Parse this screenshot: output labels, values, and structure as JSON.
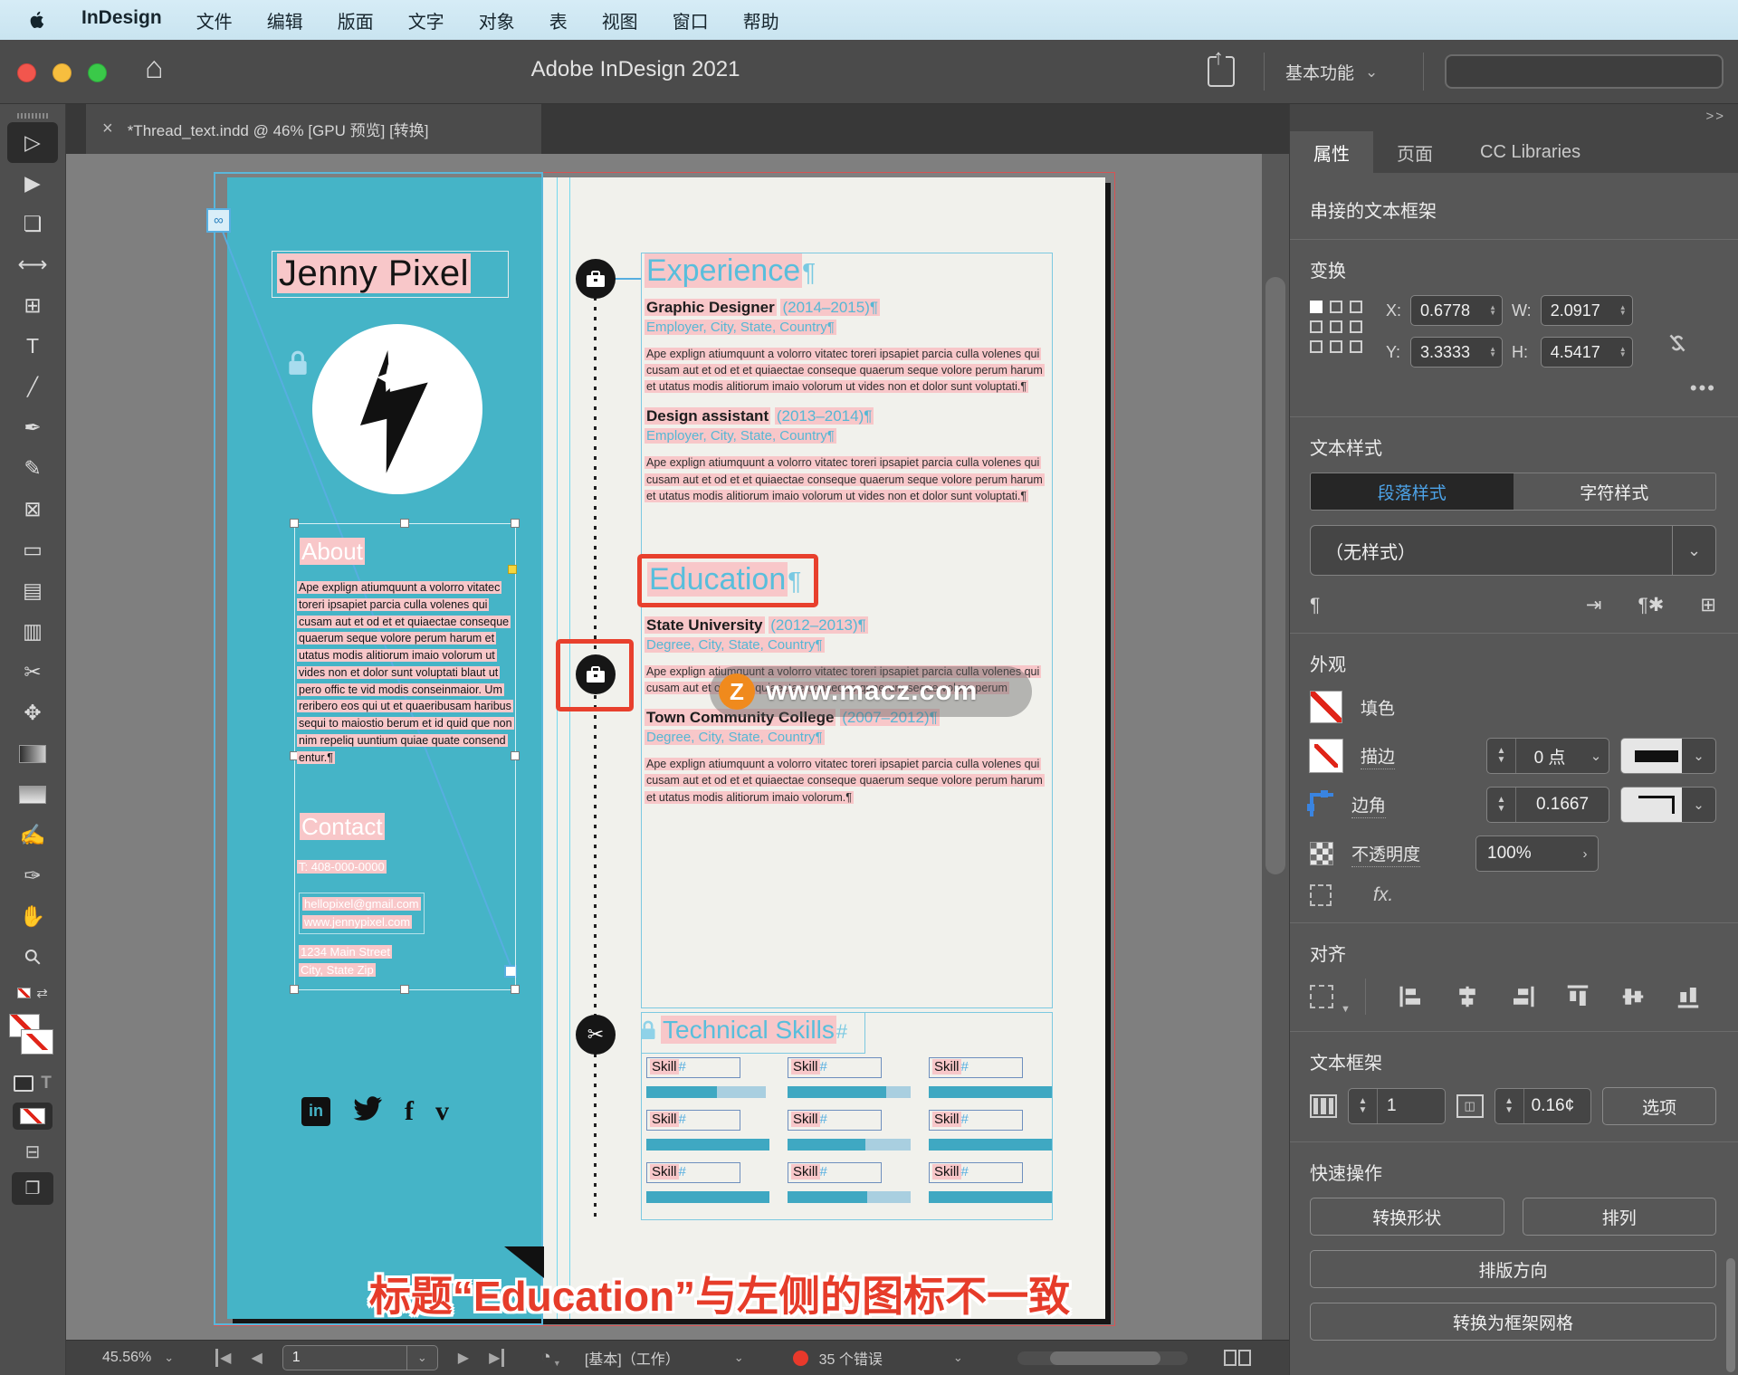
{
  "icons": {
    "double_chevron": ">>",
    "chevron_down": "⌄",
    "chevron_right": "›",
    "close": "×",
    "home": "⌂",
    "prev": "◀",
    "next": "▶",
    "up_arrow": "▲",
    "down_arrow": "▼",
    "ellipsis": "•••",
    "para": "¶",
    "para_small": "¶",
    "plus_box": "⊞",
    "redefine": "⇥",
    "para_star": "¶✱",
    "swap": "⇄",
    "link_broken": "⊘",
    "inport": "∞",
    "gauge": "◔",
    "scissors": "✂",
    "gutter": "◫"
  },
  "menu": {
    "items": [
      {
        "label": "InDesign",
        "cls": "mi bold"
      },
      {
        "label": "文件",
        "cls": "mi"
      },
      {
        "label": "编辑",
        "cls": "mi"
      },
      {
        "label": "版面",
        "cls": "mi"
      },
      {
        "label": "文字",
        "cls": "mi"
      },
      {
        "label": "对象",
        "cls": "mi"
      },
      {
        "label": "表",
        "cls": "mi"
      },
      {
        "label": "视图",
        "cls": "mi"
      },
      {
        "label": "窗口",
        "cls": "mi"
      },
      {
        "label": "帮助",
        "cls": "mi"
      }
    ]
  },
  "titlebar": {
    "title": "Adobe InDesign 2021",
    "workspace": "基本功能"
  },
  "tab": {
    "label": "*Thread_text.indd @ 46% [GPU 预览] [转换]"
  },
  "toolbar": {
    "tools": [
      {
        "name": "selection-tool",
        "glyph": "▷",
        "cls": "tool active"
      },
      {
        "name": "direct-selection-tool",
        "glyph": "▶",
        "cls": "tool"
      },
      {
        "name": "page-tool",
        "glyph": "❏",
        "cls": "tool"
      },
      {
        "name": "gap-tool",
        "glyph": "⟷",
        "cls": "tool"
      },
      {
        "name": "content-collector-tool",
        "glyph": "⊞",
        "cls": "tool"
      },
      {
        "name": "type-tool",
        "glyph": "T",
        "cls": "tool"
      },
      {
        "name": "line-tool",
        "glyph": "╱",
        "cls": "tool"
      },
      {
        "name": "pen-tool",
        "glyph": "✒",
        "cls": "tool"
      },
      {
        "name": "pencil-tool",
        "glyph": "✎",
        "cls": "tool"
      },
      {
        "name": "frame-tool",
        "glyph": "⊠",
        "cls": "tool"
      },
      {
        "name": "rectangle-tool",
        "glyph": "▭",
        "cls": "tool"
      },
      {
        "name": "table-tool",
        "glyph": "▤",
        "cls": "tool"
      },
      {
        "name": "grid-tool",
        "glyph": "▥",
        "cls": "tool"
      },
      {
        "name": "scissors-tool",
        "glyph": "✂",
        "cls": "tool"
      },
      {
        "name": "free-transform-tool",
        "glyph": "✥",
        "cls": "tool"
      }
    ],
    "tools2": [
      {
        "name": "note-tool",
        "glyph": "✍",
        "cls": "tool"
      },
      {
        "name": "eyedropper-tool",
        "glyph": "✑",
        "cls": "tool"
      },
      {
        "name": "hand-tool",
        "glyph": "✋",
        "cls": "tool"
      },
      {
        "name": "zoom-tool",
        "glyph": "⚲",
        "cls": "tool"
      }
    ]
  },
  "panel": {
    "tabs": {
      "properties": "属性",
      "pages": "页面",
      "cc": "CC Libraries"
    },
    "context_header": "串接的文本框架",
    "transform": {
      "title": "变换",
      "x_label": "X:",
      "x": "0.6778",
      "y_label": "Y:",
      "y": "3.3333",
      "w_label": "W:",
      "w": "2.0917",
      "h_label": "H:",
      "h": "4.5417"
    },
    "text_styles": {
      "title": "文本样式",
      "paragraph_tab": "段落样式",
      "character_tab": "字符样式",
      "current_style": "（无样式）"
    },
    "appearance": {
      "title": "外观",
      "fill_label": "填色",
      "stroke_label": "描边",
      "stroke_weight": "0 点",
      "corner_label": "边角",
      "corner_value": "0.1667",
      "opacity_label": "不透明度",
      "opacity_value": "100%",
      "fx_label": "fx."
    },
    "align": {
      "title": "对齐"
    },
    "text_frame": {
      "title": "文本框架",
      "columns": "1",
      "gutter": "0.16¢",
      "options_label": "选项"
    },
    "quick_actions": {
      "title": "快速操作",
      "btn1": "转换形状",
      "btn2": "排列",
      "btn3": "排版方向",
      "btn4": "转换为框架网格"
    }
  },
  "statusbar": {
    "zoom": "45.56%",
    "page": "1",
    "preset": "[基本]（工作）",
    "error_count": "35 个错误"
  },
  "doc": {
    "name": "Jenny Pixel",
    "about_title": "About",
    "about_body": "Ape explign atiumquunt a volorro vitatec toreri ipsapiet parcia culla volenes qui cusam aut et od et et quiaectae conseque quaerum seque volore perum harum et utatus modis alitiorum imaio volorum ut vides non et dolor sunt voluptati blaut ut pero offic te vid modis conseinmaior. Um reribero eos qui ut et quaeribusam haribus sequi to maiostio berum et id quid que non nim repeliq uuntium quiae quate consend entur.¶",
    "contact_title": "Contact",
    "contact_phone": "T: 408-000-0000",
    "contact_email": "hellopixel@gmail.com",
    "contact_website": "www.jennypixel.com",
    "contact_address1": "1234 Main Street",
    "contact_address2": "City, State Zip",
    "experience_title": "Experience",
    "experience_mark": "¶",
    "jobs": [
      {
        "title": "Graphic Designer",
        "dates": "(2014–2015)¶",
        "employer": "Employer, City, State, Country¶",
        "body": "Ape explign atiumquunt a volorro vitatec toreri ipsapiet parcia culla volenes qui cusam aut et od et et quiaectae conseque quaerum seque volore perum harum et utatus modis alitiorum imaio volorum ut vides non et dolor sunt voluptati.¶"
      },
      {
        "title": "Design assistant",
        "dates": "(2013–2014)¶",
        "employer": "Employer, City, State, Country¶",
        "body": "Ape explign atiumquunt a volorro vitatec toreri ipsapiet parcia culla volenes qui cusam aut et od et et quiaectae conseque quaerum seque volore perum harum et utatus modis alitiorum imaio volorum ut vides non et dolor sunt voluptati.¶"
      }
    ],
    "education_title": "Education",
    "education_mark": "¶",
    "schools": [
      {
        "title": "State University",
        "dates": "(2012–2013)¶",
        "line": "Degree, City, State, Country¶",
        "body": "Ape explign atiumquunt a volorro vitatec toreri ipsapiet parcia culla volenes qui cusam aut et od et et quiaectae conseque quaerum seque volore perum"
      },
      {
        "title": "Town Community College",
        "dates": "(2007–2012)¶",
        "line": "Degree, City, State, Country¶",
        "body": "Ape explign atiumquunt a volorro vitatec toreri ipsapiet parcia culla volenes qui cusam aut et od et et quiaectae conseque quaerum seque volore perum harum et utatus modis alitiorum imaio volorum.¶"
      }
    ],
    "skills_title": "Technical Skills",
    "skills_mark": "#",
    "skills": [
      {
        "label": "Skill",
        "mark": "#",
        "fill_style": "width:57%",
        "light_style": "left:57%;width:40%"
      },
      {
        "label": "Skill",
        "mark": "#",
        "fill_style": "width:80%",
        "light_style": "left:80%;width:20%"
      },
      {
        "label": "Skill",
        "mark": "#",
        "fill_style": "width:100%",
        "light_style": "left:100%;width:0"
      },
      {
        "label": "Skill",
        "mark": "#",
        "fill_style": "width:100%",
        "light_style": "left:100%;width:0"
      },
      {
        "label": "Skill",
        "mark": "#",
        "fill_style": "width:63%",
        "light_style": "left:63%;width:37%"
      },
      {
        "label": "Skill",
        "mark": "#",
        "fill_style": "width:100%",
        "light_style": "left:100%;width:0"
      },
      {
        "label": "Skill",
        "mark": "#",
        "fill_style": "width:100%",
        "light_style": "left:100%;width:0"
      },
      {
        "label": "Skill",
        "mark": "#",
        "fill_style": "width:65%",
        "light_style": "left:65%;width:35%"
      },
      {
        "label": "Skill",
        "mark": "#",
        "fill_style": "width:100%",
        "light_style": "left:100%;width:0"
      }
    ],
    "watermark_badge": "Z",
    "watermark_text": "www.macz.com",
    "annotation": "标题“Education”与左侧的图标不一致"
  }
}
